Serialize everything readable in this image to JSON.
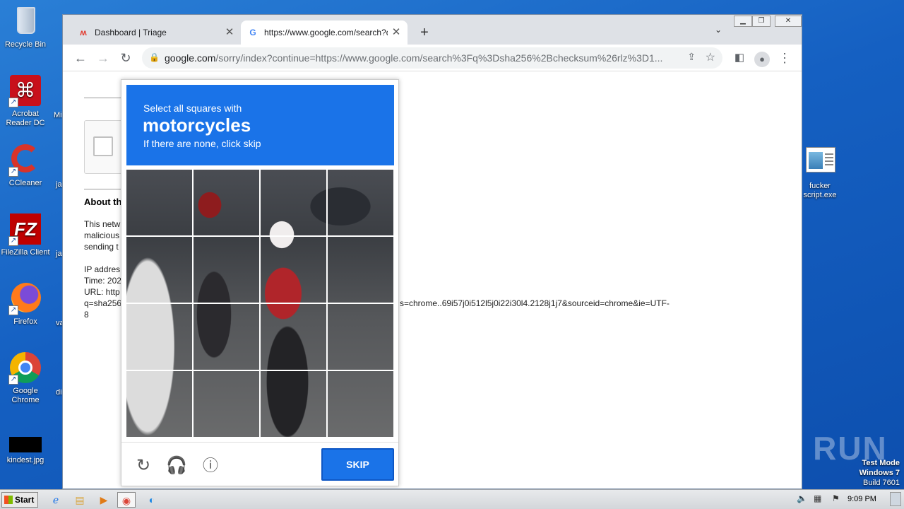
{
  "desktop": {
    "icons": [
      {
        "label": "Recycle Bin",
        "glyph": "🗑",
        "x": 0
      },
      {
        "label": "Acrobat Reader DC",
        "glyph": "A"
      },
      {
        "label": "CCleaner",
        "glyph": "C"
      },
      {
        "label": "FileZilla Client",
        "glyph": "FZ"
      },
      {
        "label": "Firefox",
        "glyph": "🦊"
      },
      {
        "label": "Google Chrome",
        "glyph": "◉"
      },
      {
        "label": "kindest.jpg",
        "glyph": ""
      }
    ],
    "peeks": [
      "Mi",
      "ja",
      "ja",
      "va",
      "di"
    ],
    "right_icon": {
      "label": "fucker script.exe"
    }
  },
  "browser": {
    "tabs": [
      {
        "title": "Dashboard | Triage",
        "favicon": "triage-icon"
      },
      {
        "title": "https://www.google.com/search?q=",
        "favicon": "google-icon"
      }
    ],
    "new_tab": "+",
    "url_host": "google.com",
    "url_path": "/sorry/index?continue=https://www.google.com/search%3Fq%3Dsha256%2Bchecksum%26rlz%3D1..."
  },
  "page": {
    "about_heading": "About th",
    "lines": [
      "This netw",
      "malicious",
      "sending t",
      "",
      "IP addres",
      "Time: 202",
      "URL: http",
      "q=sha256",
      "8"
    ],
    "url_tail": "s=chrome..69i57j0i512l5j0i22i30l4.2128j1j7&sourceid=chrome&ie=UTF-"
  },
  "captcha": {
    "instruction": "Select all squares with",
    "target": "motorcycles",
    "hint": "If there are none, click skip",
    "tile_count": 16,
    "skip_label": "SKIP"
  },
  "taskbar": {
    "start_label": "Start",
    "clock": "9:09 PM"
  },
  "overlay": {
    "watermark": "ANY RUN",
    "test_mode": "Test Mode",
    "os": "Windows 7",
    "build": "Build 7601"
  },
  "colors": {
    "accent": "#1a73e8",
    "desktop": "#1560c2"
  }
}
